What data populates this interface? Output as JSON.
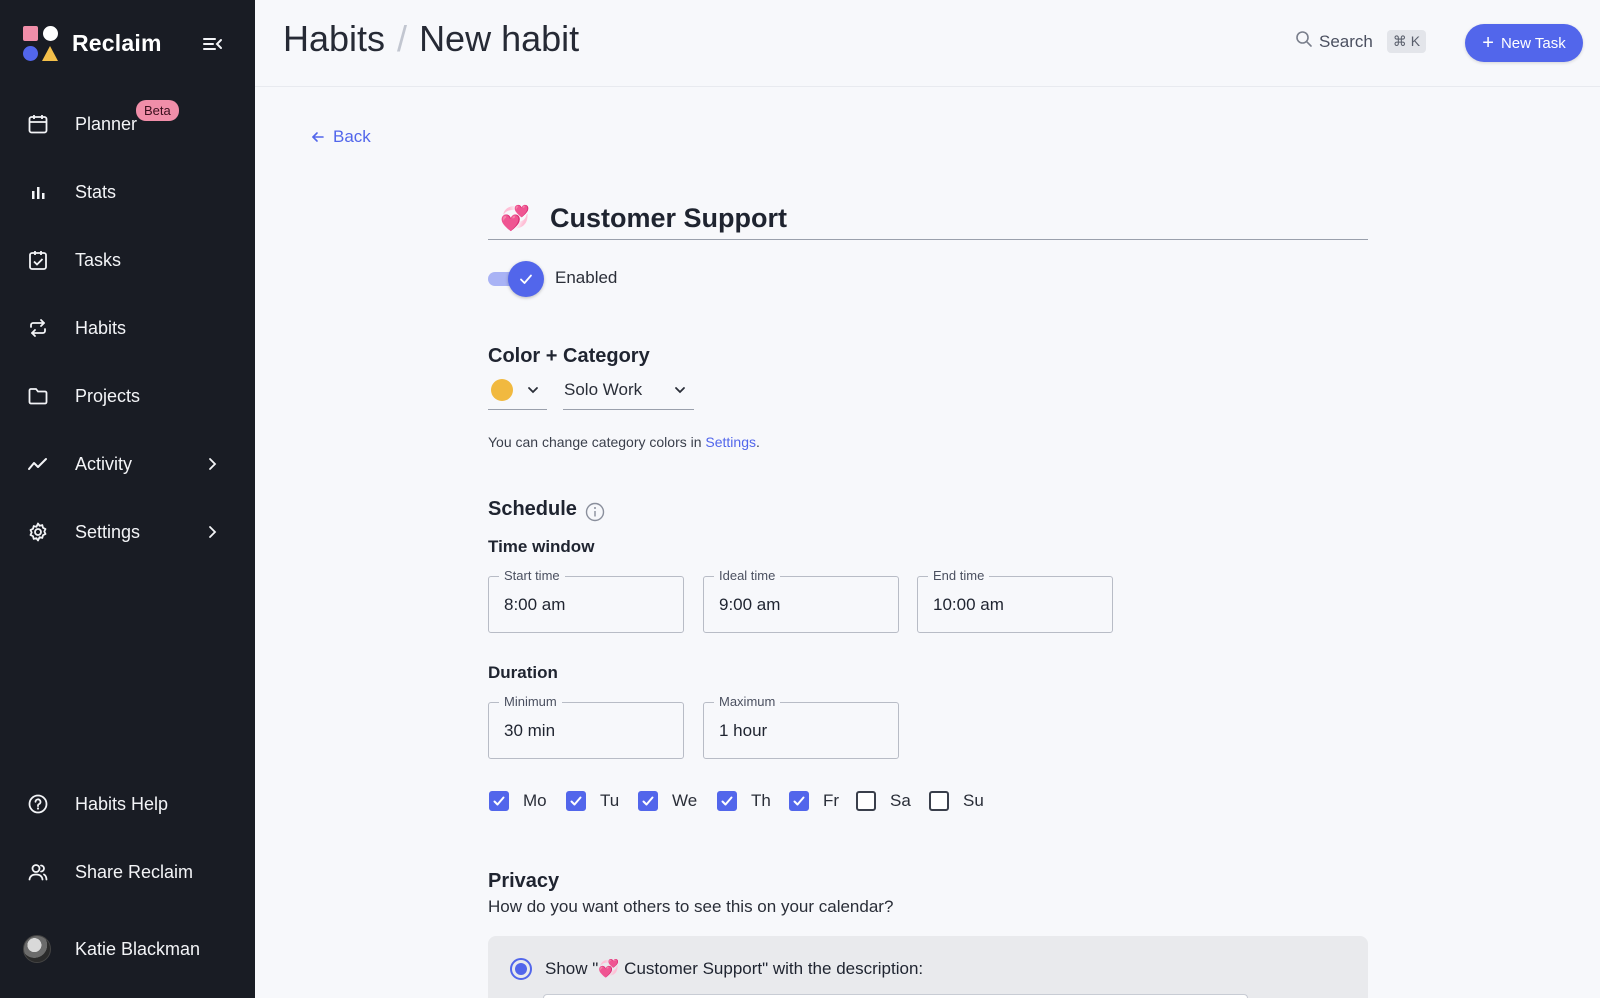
{
  "sidebar": {
    "brand": "Reclaim",
    "items": [
      {
        "label": "Planner",
        "badge": "Beta"
      },
      {
        "label": "Stats"
      },
      {
        "label": "Tasks"
      },
      {
        "label": "Habits"
      },
      {
        "label": "Projects"
      },
      {
        "label": "Activity"
      },
      {
        "label": "Settings"
      }
    ],
    "bottom_items": [
      {
        "label": "Habits Help"
      },
      {
        "label": "Share Reclaim"
      }
    ],
    "user_name": "Katie Blackman"
  },
  "header": {
    "crumb_parent": "Habits",
    "crumb_separator": "/",
    "crumb_current": "New habit",
    "search_label": "Search",
    "search_shortcut": "⌘ K",
    "new_task_label": "New Task"
  },
  "form": {
    "back_label": "Back",
    "habit_emoji": "💞",
    "habit_title": "Customer Support",
    "enabled_label": "Enabled",
    "enabled": true,
    "color_category_heading": "Color + Category",
    "color_hex": "#f1b93f",
    "category_value": "Solo Work",
    "hint_prefix": "You can change category colors in ",
    "hint_link": "Settings",
    "hint_suffix": ".",
    "schedule_heading": "Schedule",
    "time_window_heading": "Time window",
    "start_time_label": "Start time",
    "start_time_value": "8:00 am",
    "ideal_time_label": "Ideal time",
    "ideal_time_value": "9:00 am",
    "end_time_label": "End time",
    "end_time_value": "10:00 am",
    "duration_heading": "Duration",
    "min_label": "Minimum",
    "min_value": "30 min",
    "max_label": "Maximum",
    "max_value": "1 hour",
    "days": [
      {
        "label": "Mo",
        "checked": true
      },
      {
        "label": "Tu",
        "checked": true
      },
      {
        "label": "We",
        "checked": true
      },
      {
        "label": "Th",
        "checked": true
      },
      {
        "label": "Fr",
        "checked": true
      },
      {
        "label": "Sa",
        "checked": false
      },
      {
        "label": "Su",
        "checked": false
      }
    ],
    "privacy_heading": "Privacy",
    "privacy_question": "How do you want others to see this on your calendar?",
    "privacy_option_label": "Show \"💞 Customer Support\" with the description:"
  },
  "colors": {
    "accent": "#5266eb",
    "sidebar_bg": "#191c24",
    "beta_badge": "#f08ea9"
  }
}
